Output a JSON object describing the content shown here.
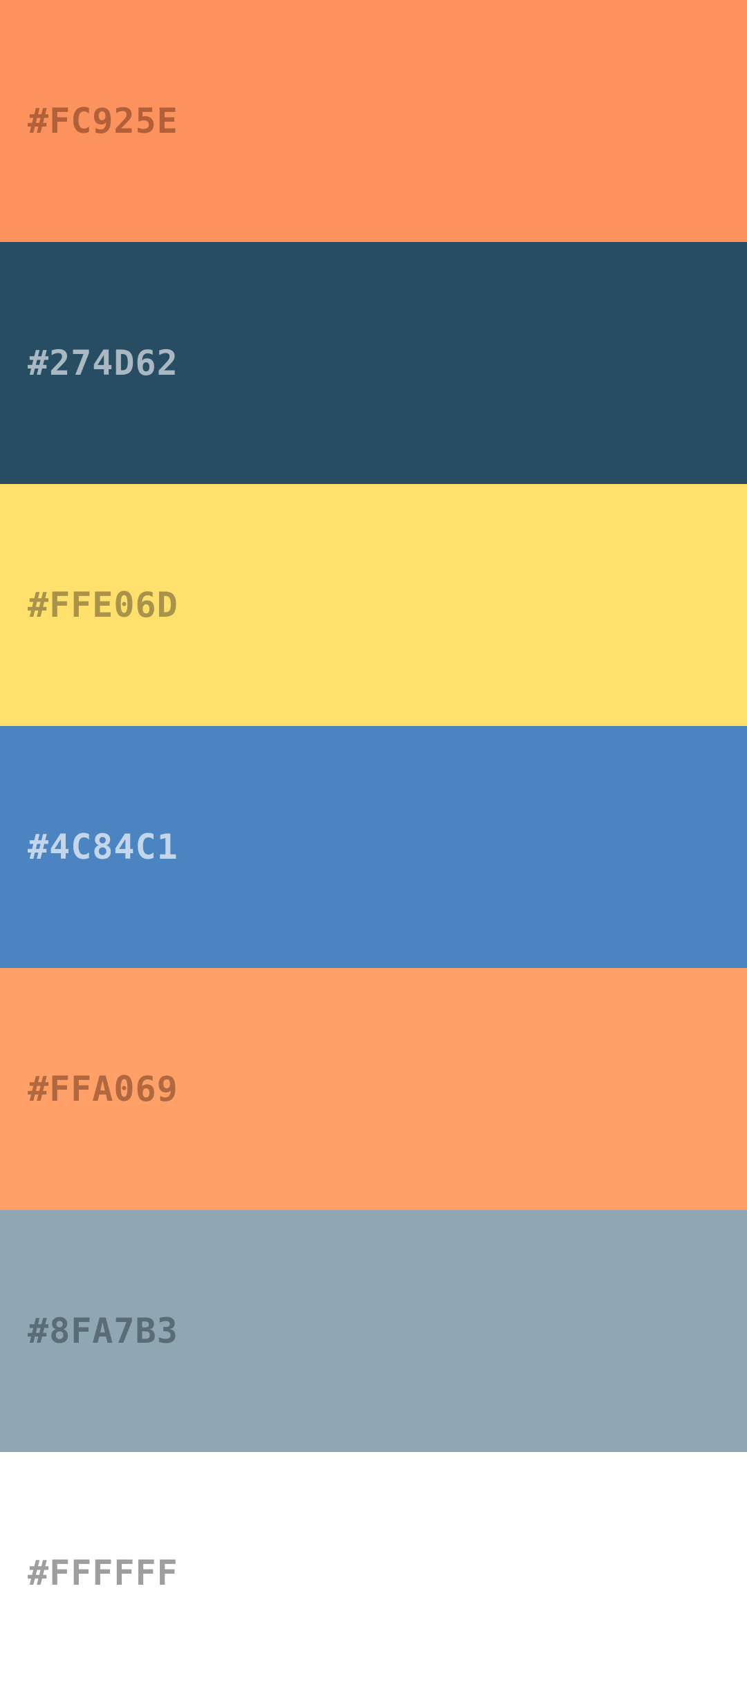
{
  "swatches": [
    {
      "hex": "#FC925E",
      "color": "#FC925E",
      "text_color": "#B2603A"
    },
    {
      "hex": "#274D62",
      "color": "#274D62",
      "text_color": "#A9B8C2"
    },
    {
      "hex": "#FFE06D",
      "color": "#FFE06D",
      "text_color": "#A9924A"
    },
    {
      "hex": "#4C84C1",
      "color": "#4C84C1",
      "text_color": "#C4D6EB"
    },
    {
      "hex": "#FFA069",
      "color": "#FFA069",
      "text_color": "#B2683F"
    },
    {
      "hex": "#8FA7B3",
      "color": "#8FA7B3",
      "text_color": "#5A6C76"
    },
    {
      "hex": "#FFFFFF",
      "color": "#FFFFFF",
      "text_color": "#9E9E9E"
    }
  ]
}
